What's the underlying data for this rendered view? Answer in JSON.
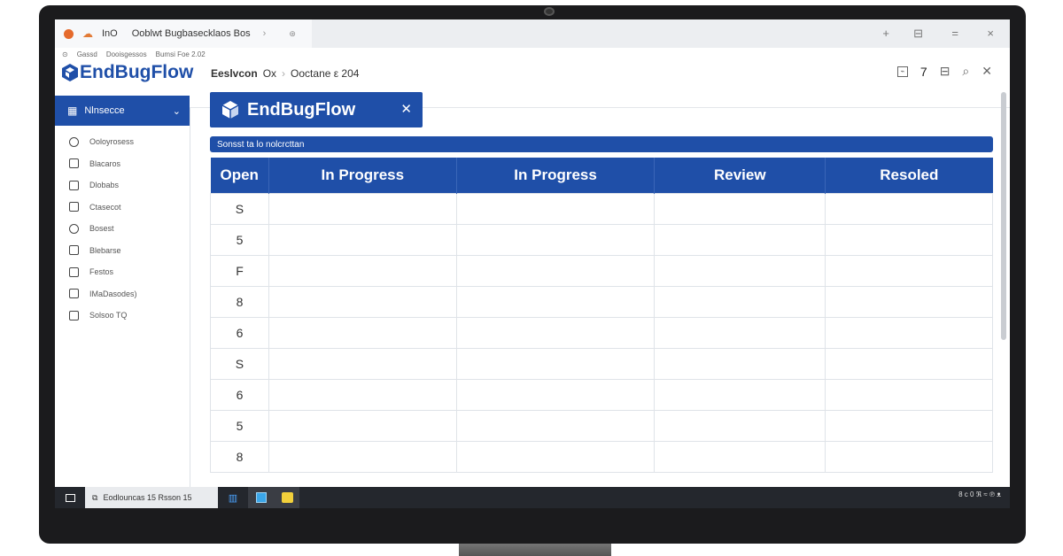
{
  "browser": {
    "tab_title": "Ooblwt Bugbasecklaos Bos",
    "tab_prefix": "InO",
    "address_items": [
      "Gassd",
      "Dooisgessos",
      "Bumsi Foe 2.02"
    ],
    "window_controls": [
      "+",
      "⊟",
      "=",
      "×"
    ]
  },
  "app": {
    "logo_text": "EndBugFlow",
    "breadcrumb": [
      "Eeslvcon",
      "Ox",
      "Ooctane ε 204"
    ],
    "header_counter": "7",
    "title_label": "EndBugFlow",
    "filter_text": "Sonsst ta lo nolcrcttan"
  },
  "sidebar": {
    "header_label": "Nlnsecce",
    "items": [
      {
        "label": "Ooloyrosess",
        "icon": "people-icon"
      },
      {
        "label": "Blacaros",
        "icon": "calendar-icon"
      },
      {
        "label": "Dlobabs",
        "icon": "document-icon"
      },
      {
        "label": "Ctasecot",
        "icon": "minus-box-icon"
      },
      {
        "label": "Bosest",
        "icon": "globe-icon"
      },
      {
        "label": "Blebarse",
        "icon": "grid-icon"
      },
      {
        "label": "Festos",
        "icon": "box-icon"
      },
      {
        "label": "IMaDasodes)",
        "icon": "list-icon"
      },
      {
        "label": "Solsoo TQ",
        "icon": "circle-box-icon"
      }
    ]
  },
  "board": {
    "columns": [
      "Open",
      "In Progress",
      "In Progress",
      "Review",
      "Resoled"
    ],
    "rows": [
      [
        "S",
        "",
        "",
        "",
        ""
      ],
      [
        "5",
        "",
        "",
        "",
        ""
      ],
      [
        "F",
        "",
        "",
        "",
        ""
      ],
      [
        "8",
        "",
        "",
        "",
        ""
      ],
      [
        "6",
        "",
        "",
        "",
        ""
      ],
      [
        "S",
        "",
        "",
        "",
        ""
      ],
      [
        "6",
        "",
        "",
        "",
        ""
      ],
      [
        "5",
        "",
        "",
        "",
        ""
      ],
      [
        "8",
        "",
        "",
        "",
        ""
      ]
    ]
  },
  "taskbar": {
    "window_label": "Eodlouncas 15 Rsson 15",
    "tray_text": "8 c 0 ℜ ≈ ℗ ᴥ"
  },
  "colors": {
    "accent": "#1f4fa8",
    "taskbar": "#24272d",
    "bezel": "#1b1b1d"
  }
}
